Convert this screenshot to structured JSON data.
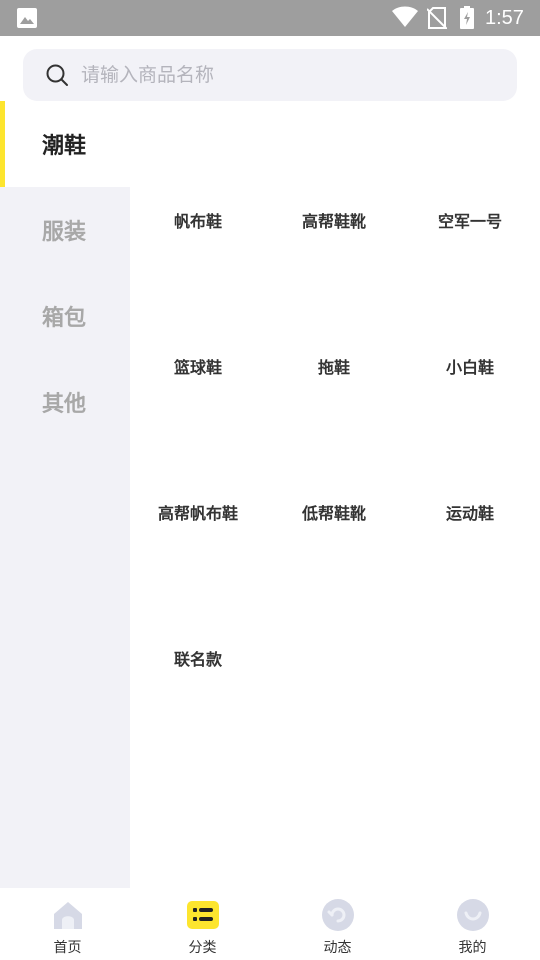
{
  "status_bar": {
    "time": "1:57"
  },
  "search": {
    "placeholder": "请输入商品名称"
  },
  "sidebar": {
    "items": [
      {
        "label": "潮鞋",
        "active": true
      },
      {
        "label": "服装",
        "active": false
      },
      {
        "label": "箱包",
        "active": false
      },
      {
        "label": "其他",
        "active": false
      }
    ]
  },
  "products": [
    "帆布鞋",
    "高帮鞋靴",
    "空军一号",
    "篮球鞋",
    "拖鞋",
    "小白鞋",
    "高帮帆布鞋",
    "低帮鞋靴",
    "运动鞋",
    "联名款"
  ],
  "bottom_nav": {
    "items": [
      {
        "label": "首页",
        "icon": "home-icon"
      },
      {
        "label": "分类",
        "icon": "category-icon",
        "active": true
      },
      {
        "label": "动态",
        "icon": "activity-icon"
      },
      {
        "label": "我的",
        "icon": "profile-icon"
      }
    ]
  },
  "colors": {
    "accent": "#fde52e",
    "sidebar_bg": "#f2f2f7",
    "status_bar": "#9e9e9e"
  }
}
